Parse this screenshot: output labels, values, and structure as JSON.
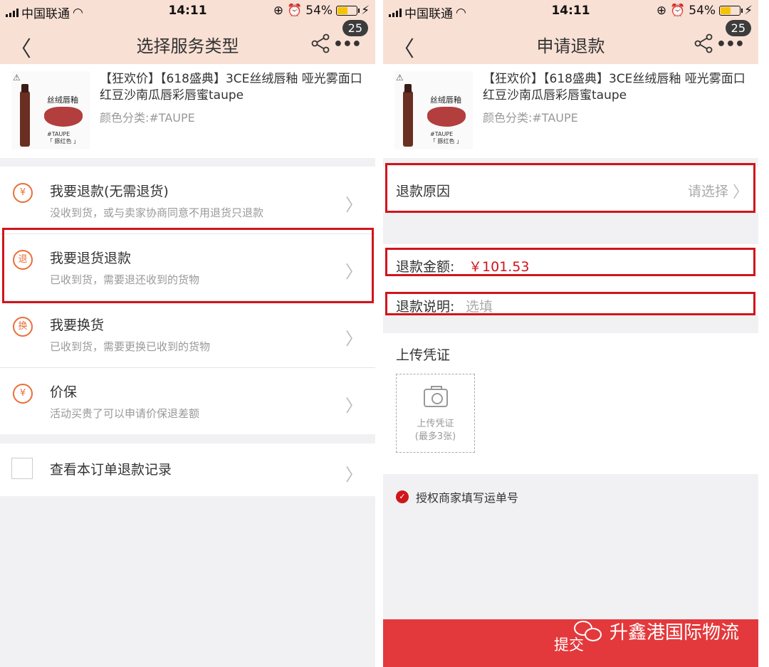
{
  "status": {
    "carrier": "中国联通",
    "time": "14:11",
    "battery": "54%",
    "battery_level": 0.54
  },
  "left": {
    "title": "选择服务类型",
    "badge": "25",
    "product": {
      "title": "【狂欢价】【618盛典】3CE丝绒唇釉 哑光雾面口红豆沙南瓜唇彩唇蜜taupe",
      "spec": "颜色分类:#TAUPE",
      "thumb_label": "丝绒唇釉",
      "thumb_caption1": "#TAUPE",
      "thumb_caption2": "「 豚红色 」"
    },
    "options": [
      {
        "icon": "¥",
        "title": "我要退款(无需退货)",
        "sub": "没收到货，或与卖家协商同意不用退货只退款"
      },
      {
        "icon": "退",
        "title": "我要退货退款",
        "sub": "已收到货，需要退还收到的货物"
      },
      {
        "icon": "换",
        "title": "我要换货",
        "sub": "已收到货，需要更换已收到的货物"
      },
      {
        "icon": "¥",
        "title": "价保",
        "sub": "活动买贵了可以申请价保退差额"
      }
    ],
    "records": "查看本订单退款记录"
  },
  "right": {
    "title": "申请退款",
    "badge": "25",
    "product": {
      "title": "【狂欢价】【618盛典】3CE丝绒唇釉 哑光雾面口红豆沙南瓜唇彩唇蜜taupe",
      "spec": "颜色分类:#TAUPE",
      "thumb_label": "丝绒唇釉",
      "thumb_caption1": "#TAUPE",
      "thumb_caption2": "「 豚红色 」"
    },
    "reason_label": "退款原因",
    "reason_placeholder": "请选择",
    "amount_label": "退款金额:",
    "amount_value": "￥101.53",
    "note_label": "退款说明:",
    "note_placeholder": "选填",
    "upload_title": "上传凭证",
    "upload_btn_line1": "上传凭证",
    "upload_btn_line2": "(最多3张)",
    "authorize": "授权商家填写运单号",
    "submit": "提交"
  },
  "watermark": "升鑫港国际物流",
  "colors": {
    "accent": "#d0151c",
    "header_bg": "#f9e0d4",
    "icon_orange": "#e8703a",
    "submit_bg": "#e4393c"
  }
}
